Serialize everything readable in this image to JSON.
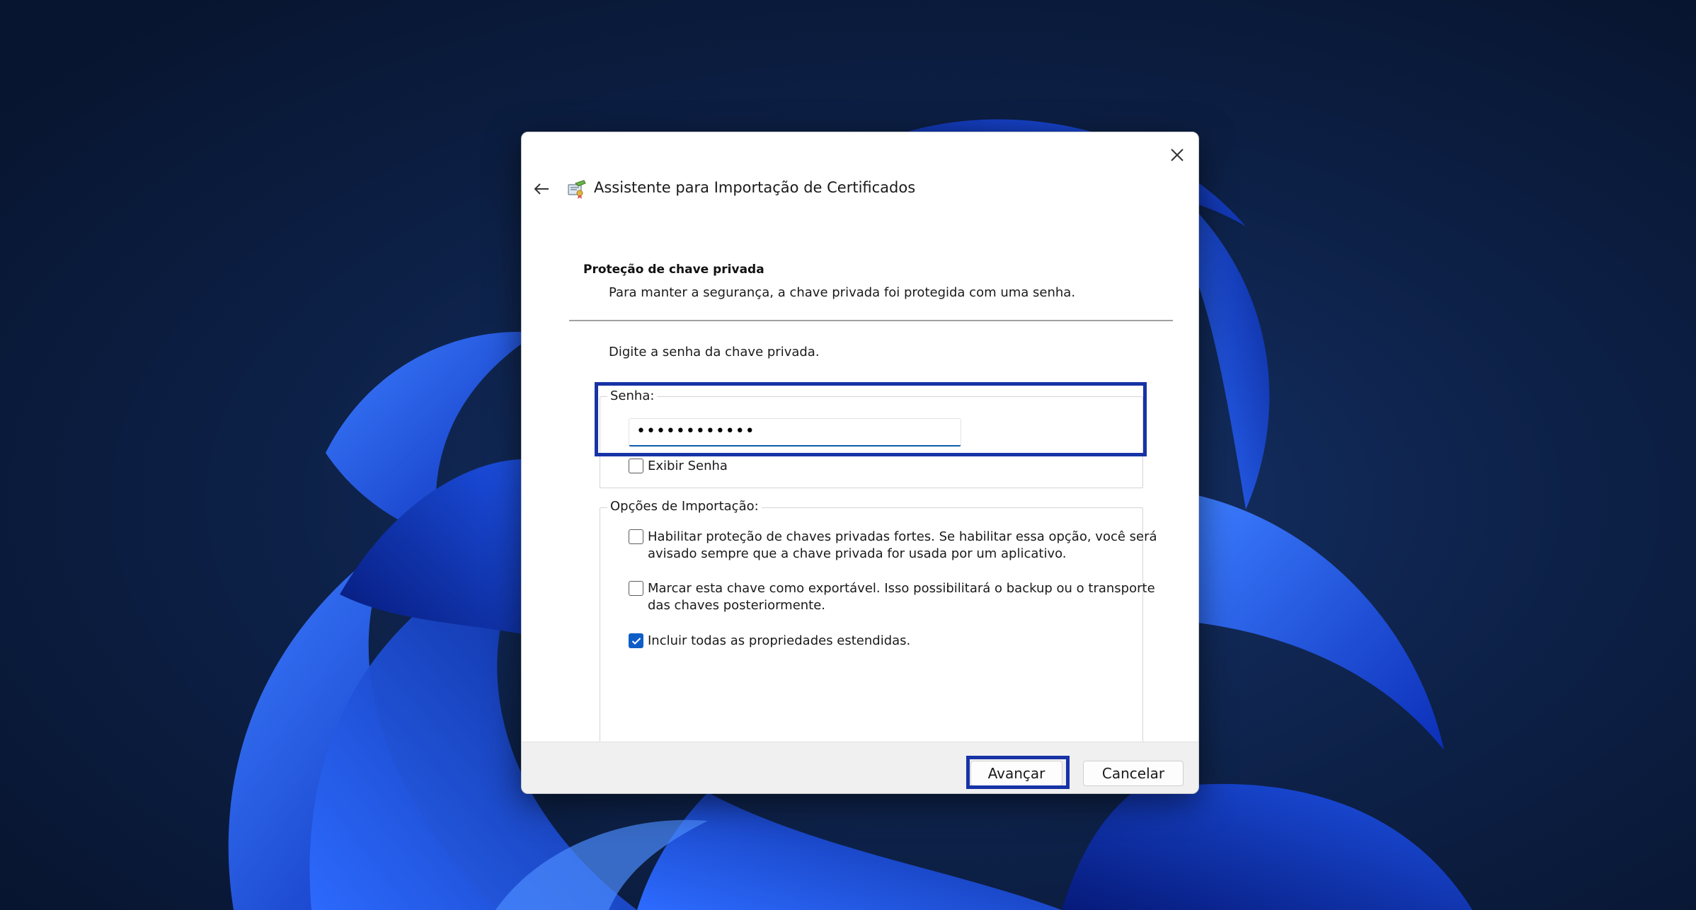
{
  "dialog": {
    "title": "Assistente para Importação de Certificados",
    "section_heading": "Proteção de chave privada",
    "section_description": "Para manter a segurança, a chave privada foi protegida com uma senha.",
    "password_prompt": "Digite a senha da chave privada.",
    "password_group_label": "Senha:",
    "password_value": "••••••••••••",
    "show_password_label": "Exibir Senha",
    "show_password_checked": false,
    "import_options_label": "Opções de Importação:",
    "options": [
      {
        "label_line1": "Habilitar proteção de chaves privadas fortes. Se habilitar essa opção, você será",
        "label_line2": "avisado sempre que a chave privada for usada por um aplicativo.",
        "checked": false
      },
      {
        "label_line1": "Marcar esta chave como exportável. Isso possibilitará o backup ou o transporte",
        "label_line2": "das chaves posteriormente.",
        "checked": false
      },
      {
        "label_line1": "Incluir todas as propriedades estendidas.",
        "label_line2": "",
        "checked": true
      }
    ],
    "buttons": {
      "next": "Avançar",
      "cancel": "Cancelar"
    }
  },
  "icons": {
    "close": "close-icon",
    "back": "back-arrow-icon",
    "certificate": "certificate-icon"
  },
  "colors": {
    "highlight": "#1733a6",
    "accent": "#0f5ec7",
    "wallpaper_bg": "#0b1d3d",
    "bloom": "#1f5bf0"
  }
}
